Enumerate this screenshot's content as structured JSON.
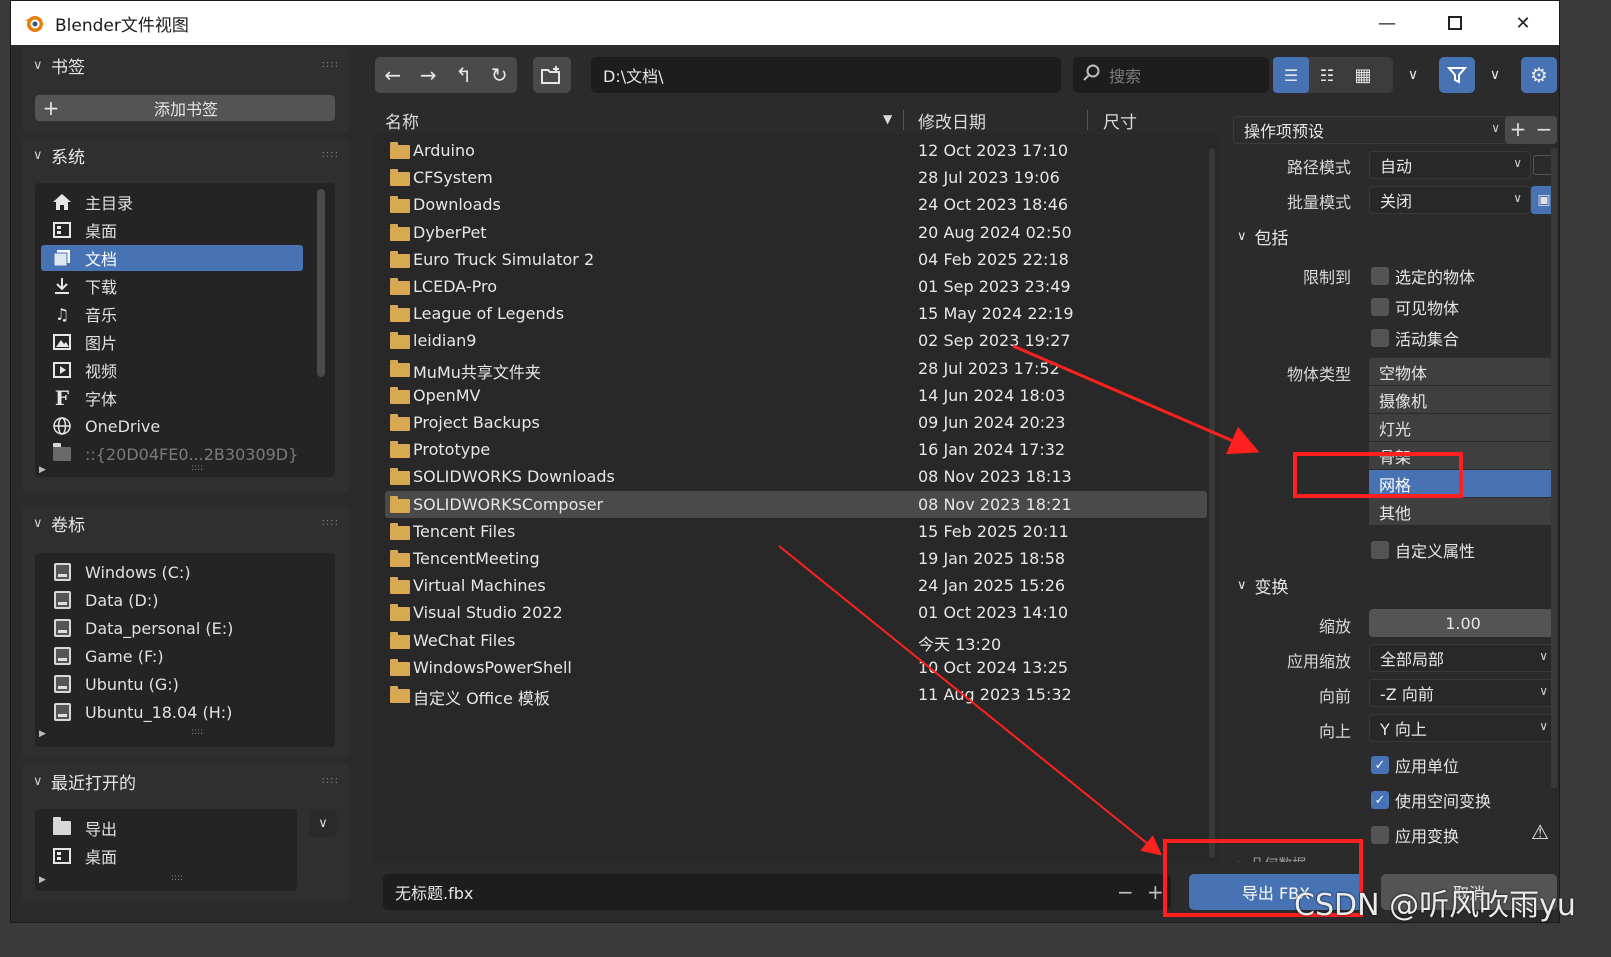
{
  "window": {
    "title": "Blender文件视图"
  },
  "left": {
    "bookmarks": {
      "title": "书签",
      "add_label": "添加书签"
    },
    "system": {
      "title": "系统",
      "items": [
        {
          "label": "主目录",
          "icon": "home-icon"
        },
        {
          "label": "桌面",
          "icon": "desktop-icon"
        },
        {
          "label": "文档",
          "icon": "documents-icon"
        },
        {
          "label": "下载",
          "icon": "download-icon"
        },
        {
          "label": "音乐",
          "icon": "music-icon"
        },
        {
          "label": "图片",
          "icon": "image-icon"
        },
        {
          "label": "视频",
          "icon": "video-icon"
        },
        {
          "label": "字体",
          "icon": "font-icon"
        },
        {
          "label": "OneDrive",
          "icon": "globe-icon"
        },
        {
          "label": "::{20D04FE0...2B30309D}",
          "icon": "folder-icon"
        }
      ]
    },
    "volumes": {
      "title": "卷标",
      "items": [
        "Windows (C:)",
        "Data (D:)",
        "Data_personal (E:)",
        "Game (F:)",
        "Ubuntu (G:)",
        "Ubuntu_18.04 (H:)"
      ]
    },
    "recent": {
      "title": "最近打开的",
      "items": [
        "导出",
        "桌面"
      ]
    }
  },
  "toolbar": {
    "path": "D:\\文档\\",
    "search_placeholder": "搜索"
  },
  "filelist": {
    "col_name": "名称",
    "col_date": "修改日期",
    "col_size": "尺寸",
    "rows": [
      {
        "name": "Arduino",
        "date": "12 Oct 2023 17:10"
      },
      {
        "name": "CFSystem",
        "date": "28 Jul 2023 19:06"
      },
      {
        "name": "Downloads",
        "date": "24 Oct 2023 18:46"
      },
      {
        "name": "DyberPet",
        "date": "20 Aug 2024 02:50"
      },
      {
        "name": "Euro Truck Simulator 2",
        "date": "04 Feb 2025 22:18"
      },
      {
        "name": "LCEDA-Pro",
        "date": "01 Sep 2023 23:49"
      },
      {
        "name": "League of Legends",
        "date": "15 May 2024 22:19"
      },
      {
        "name": "leidian9",
        "date": "02 Sep 2023 19:27"
      },
      {
        "name": "MuMu共享文件夹",
        "date": "28 Jul 2023 17:52"
      },
      {
        "name": "OpenMV",
        "date": "14 Jun 2024 18:03"
      },
      {
        "name": "Project Backups",
        "date": "09 Jun 2024 20:23"
      },
      {
        "name": "Prototype",
        "date": "16 Jan 2024 17:32"
      },
      {
        "name": "SOLIDWORKS Downloads",
        "date": "08 Nov 2023 18:13"
      },
      {
        "name": "SOLIDWORKSComposer",
        "date": "08 Nov 2023 18:21"
      },
      {
        "name": "Tencent Files",
        "date": "15 Feb 2025 20:11"
      },
      {
        "name": "TencentMeeting",
        "date": "19 Jan 2025 18:58"
      },
      {
        "name": "Virtual Machines",
        "date": "24 Jan 2025 15:26"
      },
      {
        "name": "Visual Studio 2022",
        "date": "01 Oct 2023 14:10"
      },
      {
        "name": "WeChat Files",
        "date": "今天 13:20"
      },
      {
        "name": "WindowsPowerShell",
        "date": "10 Oct 2024 13:25"
      },
      {
        "name": "自定义 Office 模板",
        "date": "11 Aug 2023 15:32"
      }
    ]
  },
  "bottom": {
    "filename": "无标题.fbx",
    "export_label": "导出 FBX",
    "cancel_label": "取消"
  },
  "right": {
    "preset_label": "操作项预设",
    "path_mode_label": "路径模式",
    "path_mode_value": "自动",
    "batch_mode_label": "批量模式",
    "batch_mode_value": "关闭",
    "include_title": "包括",
    "limit_label": "限制到",
    "limit_options": [
      "选定的物体",
      "可见物体",
      "活动集合"
    ],
    "object_types_label": "物体类型",
    "object_types": [
      "空物体",
      "摄像机",
      "灯光",
      "骨架",
      "网格",
      "其他"
    ],
    "custom_props_label": "自定义属性",
    "transform_title": "变换",
    "scale_label": "缩放",
    "scale_value": "1.00",
    "apply_scale_label": "应用缩放",
    "apply_scale_value": "全部局部",
    "forward_label": "向前",
    "forward_value": "-Z 向前",
    "up_label": "向上",
    "up_value": "Y 向上",
    "apply_unit_label": "应用单位",
    "use_space_transform_label": "使用空间变换",
    "apply_transform_label": "应用变换",
    "geometry_title": "几何数据"
  },
  "watermark": "CSDN @听风吹雨yu",
  "colors": {
    "accent": "#4772b3",
    "annotation": "#ff2020",
    "folder": "#d9a852"
  }
}
